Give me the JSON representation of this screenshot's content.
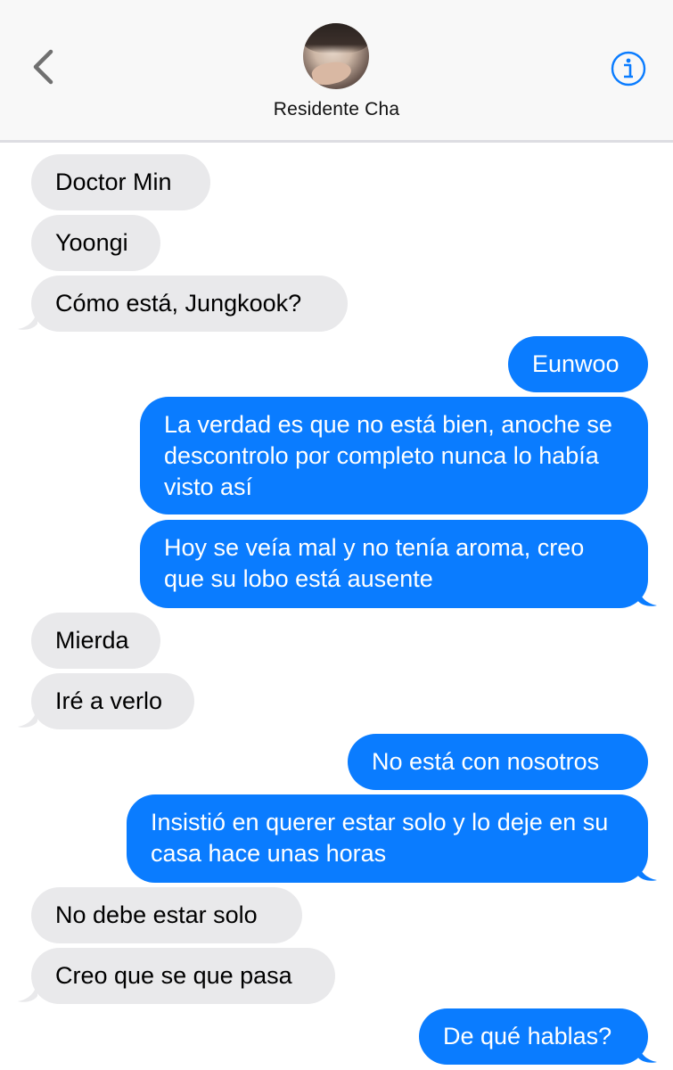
{
  "header": {
    "contact_name": "Residente Cha",
    "back_icon": "chevron-left-icon",
    "info_icon": "info-icon",
    "accent": "#0a7cff"
  },
  "colors": {
    "incoming_bubble": "#e9e9eb",
    "outgoing_bubble": "#0a7cff",
    "outgoing_text": "#ffffff"
  },
  "messages": [
    {
      "sender": "contact",
      "text": "Doctor Min"
    },
    {
      "sender": "contact",
      "text": "Yoongi"
    },
    {
      "sender": "contact",
      "text": "Cómo está, Jungkook?"
    },
    {
      "sender": "me",
      "text": "Eunwoo"
    },
    {
      "sender": "me",
      "text": "La verdad es que no está bien, anoche se descontrolo por completo nunca lo había visto así"
    },
    {
      "sender": "me",
      "text": "Hoy se veía mal y no tenía aroma, creo que su lobo está ausente"
    },
    {
      "sender": "contact",
      "text": "Mierda"
    },
    {
      "sender": "contact",
      "text": "Iré a verlo"
    },
    {
      "sender": "me",
      "text": "No está con nosotros"
    },
    {
      "sender": "me",
      "text": "Insistió en querer estar solo y lo deje en su casa hace unas horas"
    },
    {
      "sender": "contact",
      "text": "No debe estar solo"
    },
    {
      "sender": "contact",
      "text": "Creo que se que pasa"
    },
    {
      "sender": "me",
      "text": "De qué hablas?"
    }
  ]
}
